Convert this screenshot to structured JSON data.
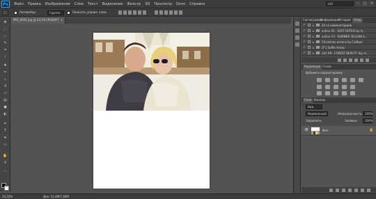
{
  "app": {
    "logo": "Ps"
  },
  "menu": [
    "Файл",
    "Правка",
    "Изображение",
    "Слои",
    "Текст",
    "Выделение",
    "Фильтр",
    "3D",
    "Просмотр",
    "Окно",
    "Справка"
  ],
  "window_controls": [
    "–",
    "□",
    "✕"
  ],
  "workspace": "(of)",
  "options_bar": {
    "auto_select_label": "Автовыбор:",
    "auto_select_value": "Группа",
    "transform_label": "Показать управл. элем."
  },
  "document_tab": {
    "title": "IMG_9261.jpg @ 33,3% (RGB/8*)",
    "close": "×"
  },
  "status_bar": {
    "zoom": "33,33%",
    "doc_info": "Док: 12,4M/7,30M"
  },
  "panels": {
    "top_tabs": [
      "Гистограмма",
      "Информация",
      "История",
      "Опер"
    ],
    "actions": [
      {
        "check": "✓",
        "name": "24 се комментариев"
      },
      {
        "check": "✓",
        "name": "action 01 - SOFT RETRO by m..."
      },
      {
        "check": "✓",
        "name": "action 13 - SUMMER YELLOW b..."
      },
      {
        "check": "✓",
        "name": "Christmas actions by Caifbee"
      },
      {
        "check": "✓",
        "name": "LT's Soffie Action"
      },
      {
        "check": "✓",
        "name": "(ot) #8 - FOREST BEAUTY (by m..."
      }
    ],
    "adjustments": {
      "tab_active": "Коррекция",
      "tab_other": "Стили",
      "subtitle": "Добавить корректировку"
    },
    "layers": {
      "tab_active": "Слои",
      "tab_other": "Каналы",
      "filter": "Вид",
      "blend_mode": "Нормальный",
      "opacity_label": "Непрозрачность:",
      "opacity_value": "100%",
      "lock_label": "Закрепить:",
      "fill_label": "Заливка:",
      "fill_value": "100%",
      "layer_name": "Фон",
      "eye_icon": "eye-icon",
      "lock_icon": "lock-icon"
    }
  },
  "colors": {
    "workspace_bg": "#535353",
    "panel_bg": "#535353",
    "bar_bg": "#3c3c3c",
    "document_bg": "#ffffff"
  }
}
